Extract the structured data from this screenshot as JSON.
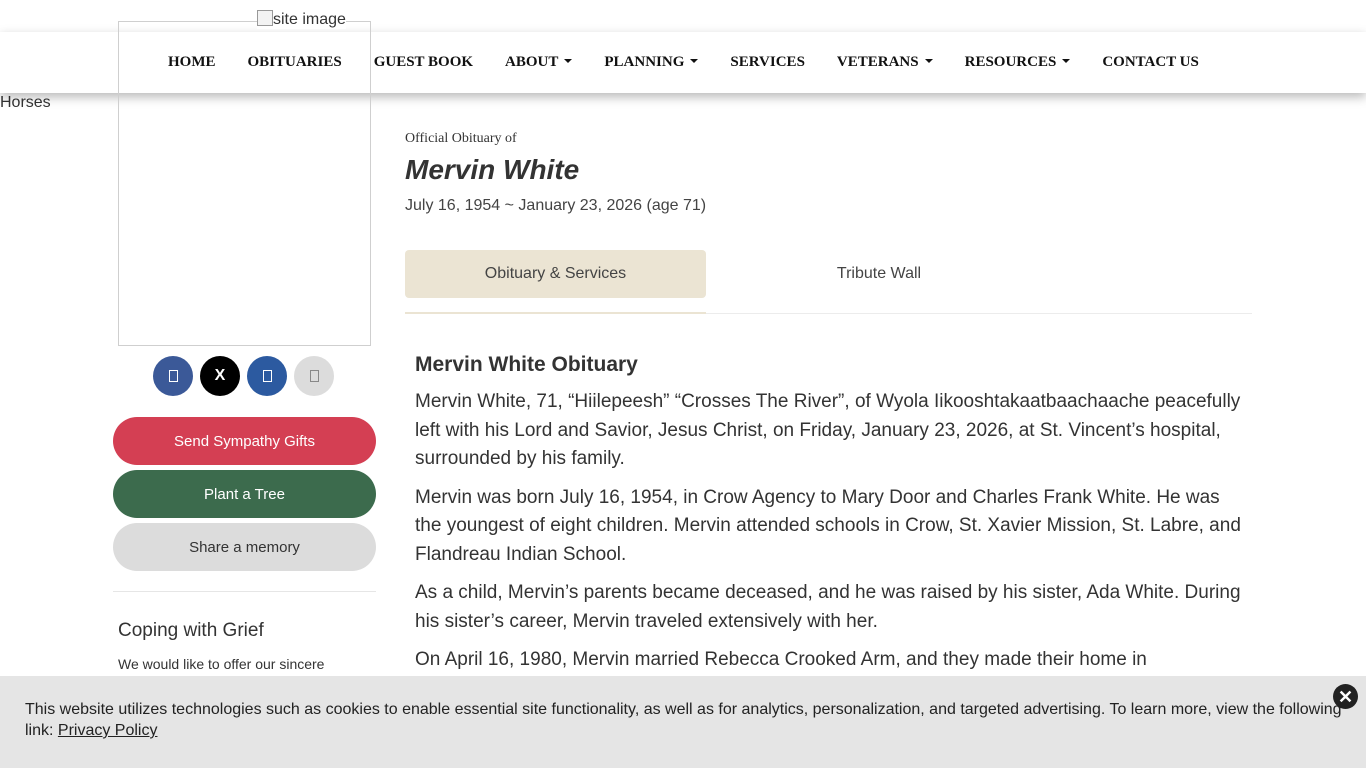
{
  "site_image_alt": "site image",
  "nav": {
    "items": [
      {
        "label": "HOME",
        "dropdown": false
      },
      {
        "label": "OBITUARIES",
        "dropdown": false
      },
      {
        "label": "GUEST BOOK",
        "dropdown": false
      },
      {
        "label": "ABOUT",
        "dropdown": true
      },
      {
        "label": "PLANNING",
        "dropdown": true
      },
      {
        "label": "SERVICES",
        "dropdown": false
      },
      {
        "label": "VETERANS",
        "dropdown": true
      },
      {
        "label": "RESOURCES",
        "dropdown": true
      },
      {
        "label": "CONTACT US",
        "dropdown": false
      }
    ]
  },
  "sidebar": {
    "photo_overflow_text": "Horses",
    "social": [
      {
        "name": "facebook",
        "glyph": "",
        "color": "#3b5998"
      },
      {
        "name": "x-twitter",
        "glyph": "X",
        "color": "#000000"
      },
      {
        "name": "linkedin",
        "glyph": "",
        "color": "#2c5aa0"
      },
      {
        "name": "email",
        "glyph": "",
        "color": "#dcdcdc"
      }
    ],
    "send_sympathy_label": "Send Sympathy Gifts",
    "plant_tree_label": "Plant a Tree",
    "share_memory_label": "Share a memory",
    "grief_title": "Coping with Grief",
    "grief_text": "We would like to offer our sincere"
  },
  "obituary": {
    "official_label": "Official Obituary of",
    "name": "Mervin White",
    "dates": "July 16, 1954 ~ January 23, 2026 (age 71)",
    "tabs": [
      {
        "label": "Obituary & Services",
        "active": true
      },
      {
        "label": "Tribute Wall",
        "active": false
      }
    ],
    "heading": "Mervin White Obituary",
    "paragraphs": [
      "Mervin White, 71, “Hiilepeesh” “Crosses The River”, of Wyola Iikooshtakaatbaachaache peacefully left with his Lord and Savior, Jesus Christ, on Friday, January 23, 2026, at St. Vincent’s hospital, surrounded by his family.",
      "Mervin was born July 16, 1954, in Crow Agency to Mary Door and Charles Frank White.  He was the youngest of eight children. Mervin attended schools in Crow, St. Xavier Mission, St. Labre, and Flandreau Indian School.",
      "As a child, Mervin’s parents became deceased, and he was raised by his sister, Ada White. During his sister’s career, Mervin traveled extensively with her.",
      "On April 16, 1980, Mervin married Rebecca Crooked Arm, and they made their home in"
    ]
  },
  "cookie": {
    "text": "This website utilizes technologies such as cookies to enable essential site functionality, as well as for analytics, personalization, and targeted advertising. To learn more, view the following link: ",
    "link_label": "Privacy Policy",
    "close_glyph": "✕"
  },
  "colors": {
    "sympathy_button": "#d43f53",
    "tree_button": "#3c6b4d",
    "memory_button": "#dcdcdc",
    "active_tab": "#ebe4d3",
    "cookie_banner": "#e5e5e5"
  }
}
